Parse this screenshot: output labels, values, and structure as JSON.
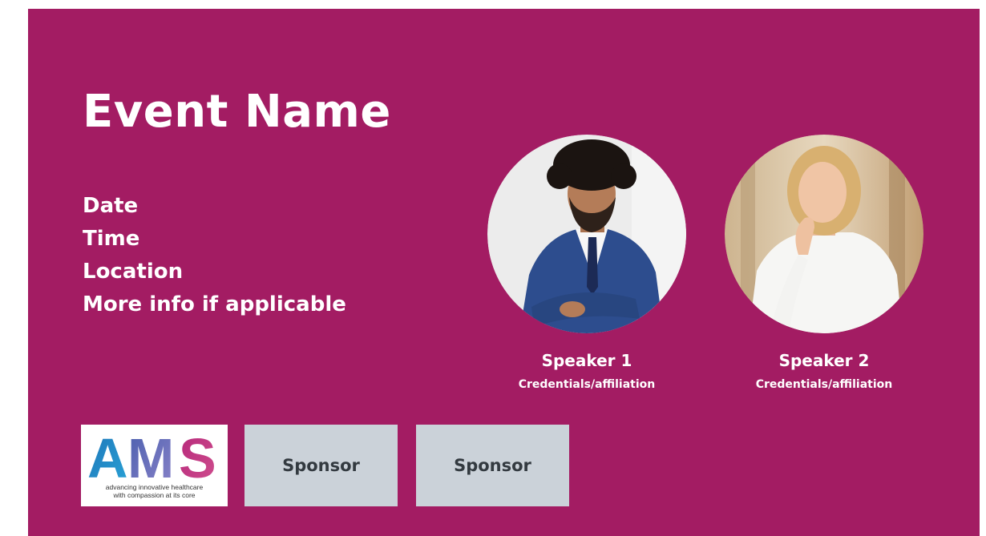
{
  "colors": {
    "background": "#a31c63",
    "text": "#ffffff",
    "sponsor_box": "#cbd2d9",
    "sponsor_text": "#333a40"
  },
  "event": {
    "title": "Event Name",
    "details": [
      "Date",
      "Time",
      "Location",
      "More info if applicable"
    ]
  },
  "speakers": [
    {
      "name": "Speaker 1",
      "credentials": "Credentials/affiliation"
    },
    {
      "name": "Speaker 2",
      "credentials": "Credentials/affiliation"
    }
  ],
  "logo": {
    "name": "AMS",
    "tagline_line1": "advancing innovative healthcare",
    "tagline_line2": "with compassion at its core"
  },
  "sponsors": [
    "Sponsor",
    "Sponsor"
  ]
}
